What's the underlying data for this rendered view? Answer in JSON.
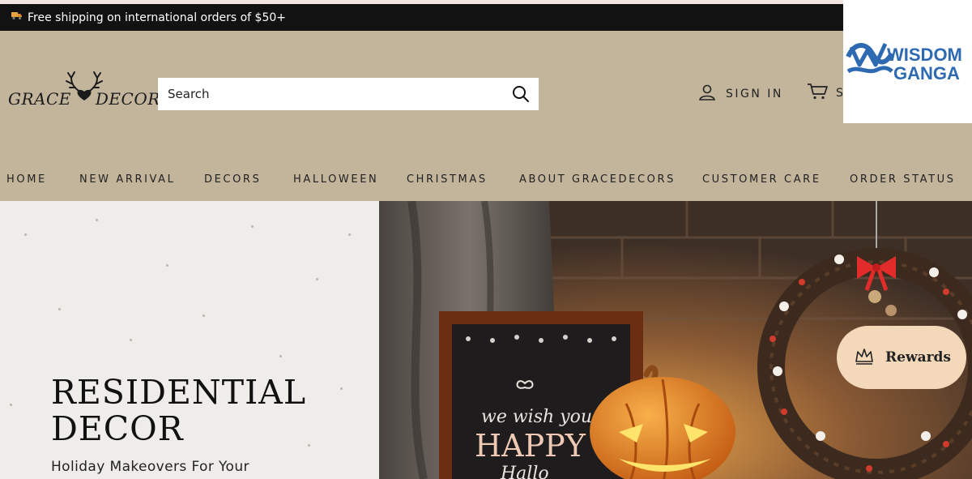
{
  "announcement": {
    "icon": "truck-icon",
    "text": "Free shipping on international orders of $50+"
  },
  "header": {
    "logo": {
      "part1": "GRACE",
      "part2": "DECOR"
    },
    "search": {
      "placeholder": "Search",
      "icon": "search-icon"
    },
    "sign_in": {
      "label": "SIGN IN",
      "icon": "user-icon"
    },
    "cart": {
      "label": "S",
      "icon": "cart-icon"
    }
  },
  "nav": {
    "items": [
      {
        "label": "HOME"
      },
      {
        "label": "NEW ARRIVAL"
      },
      {
        "label": "DECORS"
      },
      {
        "label": "HALLOWEEN"
      },
      {
        "label": "CHRISTMAS"
      },
      {
        "label": "ABOUT GRACEDECORS"
      },
      {
        "label": "CUSTOMER CARE"
      },
      {
        "label": "ORDER STATUS"
      }
    ]
  },
  "hero": {
    "title_line1": "RESIDENTIAL",
    "title_line2": "DECOR",
    "subtitle": "Holiday Makeovers For Your",
    "sign_line1": "we wish you a",
    "sign_line2": "HAPPY",
    "sign_line3": "Hallo"
  },
  "watermark": {
    "line1": "WISDOM",
    "line2": "GANGA"
  },
  "rewards": {
    "label": "Rewards",
    "icon": "crown-icon"
  },
  "colors": {
    "header_bg": "#c2b59c",
    "announcement_bg": "#121212",
    "rewards_bg": "#f3d8ba",
    "watermark_blue": "#2e6ab1"
  }
}
